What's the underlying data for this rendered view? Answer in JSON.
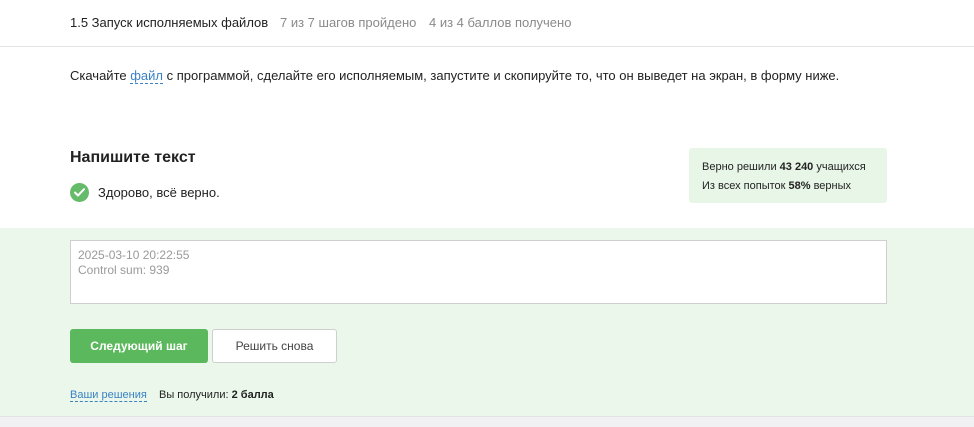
{
  "header": {
    "lesson_title": "1.5 Запуск исполняемых файлов",
    "steps_progress": "7 из 7 шагов пройдено",
    "score_progress": "4 из 4 баллов  получено"
  },
  "task": {
    "instruction_before": "Скачайте ",
    "file_link_label": "файл",
    "instruction_after": " с программой, сделайте его исполняемым, запустите и скопируйте то, что он выведет на экран, в форму ниже.",
    "header": "Напишите текст",
    "result_message": "Здорово, всё верно."
  },
  "stats": {
    "solved_prefix": "Верно решили ",
    "solved_count": "43 240",
    "solved_suffix": " учащихся",
    "attempts_prefix": "Из всех попыток ",
    "attempts_percent": "58%",
    "attempts_suffix": " верных"
  },
  "answer": {
    "lines": [
      "2025-03-10 20:22:55",
      "Control sum: 939"
    ]
  },
  "actions": {
    "next_step_label": "Следующий шаг",
    "retry_label": "Решить снова"
  },
  "footer": {
    "solutions_link": "Ваши решения",
    "points_prefix": "Вы получили: ",
    "points_value": "2 балла"
  },
  "colors": {
    "accent_green": "#5cb85c",
    "success_icon": "#66bb6a",
    "panel_green": "#eaf7ea",
    "link_blue": "#3b82c4"
  },
  "icons": {
    "result_icon": "check-circle-icon"
  }
}
